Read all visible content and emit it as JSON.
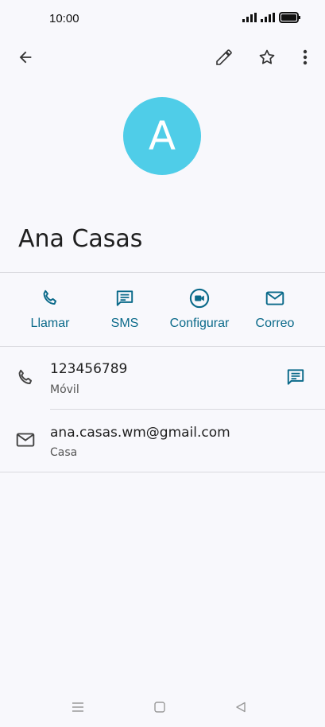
{
  "status_bar": {
    "time": "10:00"
  },
  "contact": {
    "avatar_letter": "A",
    "name": "Ana Casas"
  },
  "actions": [
    {
      "label": "Llamar",
      "icon": "phone-icon"
    },
    {
      "label": "SMS",
      "icon": "message-icon"
    },
    {
      "label": "Configurar",
      "icon": "video-icon"
    },
    {
      "label": "Correo",
      "icon": "mail-icon"
    }
  ],
  "details": {
    "phone": {
      "value": "123456789",
      "type": "Móvil"
    },
    "email": {
      "value": "ana.casas.wm@gmail.com",
      "type": "Casa"
    }
  },
  "colors": {
    "accent": "#0b6a8a",
    "avatar": "#4fcde8",
    "background": "#f8f8fc"
  }
}
